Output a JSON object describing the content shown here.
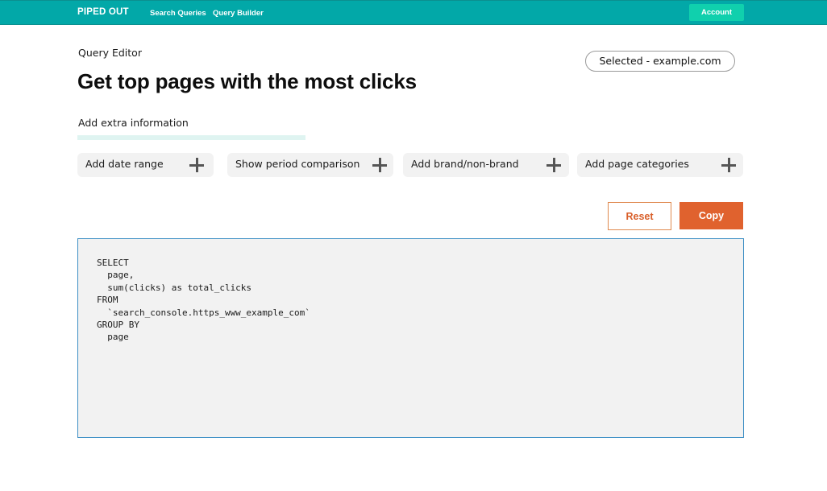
{
  "topbar": {
    "brand": "PIPED OUT",
    "nav": [
      {
        "label": "Search Queries"
      },
      {
        "label": "Query Builder"
      }
    ],
    "account_label": "Account",
    "bg_color": "#02a8a8",
    "account_color": "#10d0ad"
  },
  "header": {
    "eyebrow": "Query Editor",
    "title": "Get top pages with the most clicks",
    "selected_site": "Selected - example.com"
  },
  "extras": {
    "label": "Add extra information",
    "options": [
      {
        "label": "Add date range",
        "icon": "plus-icon"
      },
      {
        "label": "Show period comparison",
        "icon": "plus-icon"
      },
      {
        "label": "Add brand/non-brand",
        "icon": "plus-icon"
      },
      {
        "label": "Add page categories",
        "icon": "plus-icon"
      }
    ]
  },
  "actions": {
    "reset_label": "Reset",
    "copy_label": "Copy",
    "accent_color": "#e0622e"
  },
  "editor": {
    "code": "SELECT\n  page,\n  sum(clicks) as total_clicks\nFROM\n  `search_console.https_www_example_com`\nGROUP BY\n  page"
  }
}
